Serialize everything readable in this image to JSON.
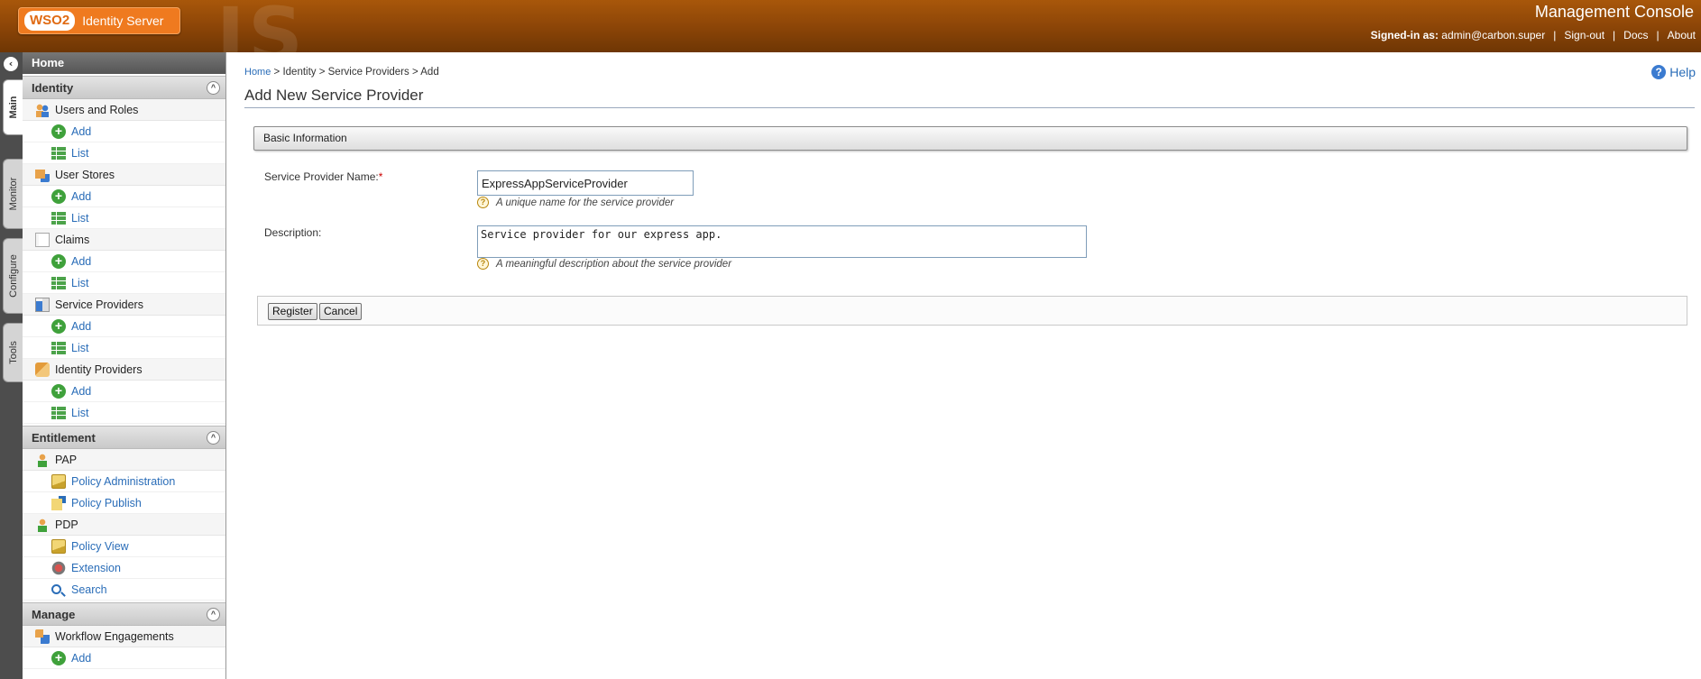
{
  "header": {
    "logo_brand": "WSO2",
    "product_name": "Identity Server",
    "console_title": "Management Console",
    "signed_in_label": "Signed-in as:",
    "signed_in_user": "admin@carbon.super",
    "nav_signout": "Sign-out",
    "nav_docs": "Docs",
    "nav_about": "About",
    "separator": "|",
    "watermark": "IS"
  },
  "tabs": {
    "main": "Main",
    "monitor": "Monitor",
    "configure": "Configure",
    "tools": "Tools"
  },
  "sidebar": {
    "home": "Home",
    "identity": {
      "title": "Identity",
      "users_and_roles": "Users and Roles",
      "user_stores": "User Stores",
      "claims": "Claims",
      "service_providers": "Service Providers",
      "identity_providers": "Identity Providers",
      "add": "Add",
      "list": "List"
    },
    "entitlement": {
      "title": "Entitlement",
      "pap": "PAP",
      "policy_administration": "Policy Administration",
      "policy_publish": "Policy Publish",
      "pdp": "PDP",
      "policy_view": "Policy View",
      "extension": "Extension",
      "search": "Search"
    },
    "manage": {
      "title": "Manage",
      "workflow_engagements": "Workflow Engagements",
      "add": "Add"
    }
  },
  "main": {
    "breadcrumb": {
      "home": "Home",
      "sep": " > ",
      "identity": "Identity",
      "service_providers": "Service Providers",
      "add": "Add"
    },
    "help": "Help",
    "page_title": "Add New Service Provider",
    "basic_info_title": "Basic Information",
    "form": {
      "name_label": "Service Provider Name:",
      "required_mark": "*",
      "name_value": "ExpressAppServiceProvider",
      "name_hint": "A unique name for the service provider",
      "description_label": "Description:",
      "description_value": "Service provider for our express app.",
      "description_hint": "A meaningful description about the service provider"
    },
    "buttons": {
      "register": "Register",
      "cancel": "Cancel"
    }
  },
  "colors": {
    "header_brown": "#8a4407",
    "logo_orange": "#ef7a1f",
    "link_blue": "#2a6db8",
    "add_green": "#3fa13b",
    "required_red": "#cc0000"
  }
}
